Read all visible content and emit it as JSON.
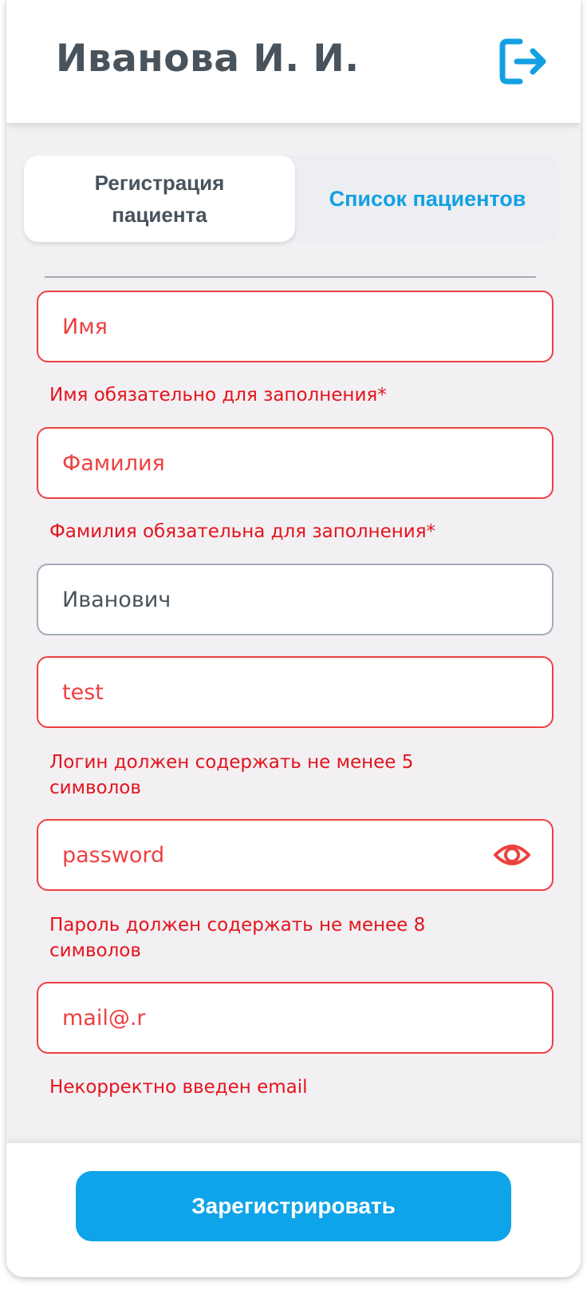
{
  "header": {
    "title": "Иванова И. И.",
    "logout_icon": "logout-arrow-icon"
  },
  "tabs": [
    {
      "label": "Регистрация пациента",
      "active": true
    },
    {
      "label": "Список пациентов",
      "active": false
    }
  ],
  "form": {
    "first_name": {
      "placeholder": "Имя",
      "value": "",
      "error": "Имя обязательно для заполнения*"
    },
    "last_name": {
      "placeholder": "Фамилия",
      "value": "",
      "error": "Фамилия обязательна для заполнения*"
    },
    "middle_name": {
      "placeholder": "",
      "value": "Иванович"
    },
    "login": {
      "placeholder": "",
      "value": "test",
      "error": "Логин должен содержать не менее 5 символов"
    },
    "password": {
      "placeholder": "password",
      "value": "",
      "error": "Пароль должен содержать не менее 8 символов",
      "toggle_icon": "eye-icon"
    },
    "email": {
      "placeholder": "",
      "value": "mail@.r",
      "error": "Некорректно введен email"
    }
  },
  "footer": {
    "submit_label": "Зарегистрировать"
  },
  "colors": {
    "accent": "#0ea4e9",
    "error": "#ec4141",
    "text": "#48535c",
    "background": "#f2f0f2"
  }
}
